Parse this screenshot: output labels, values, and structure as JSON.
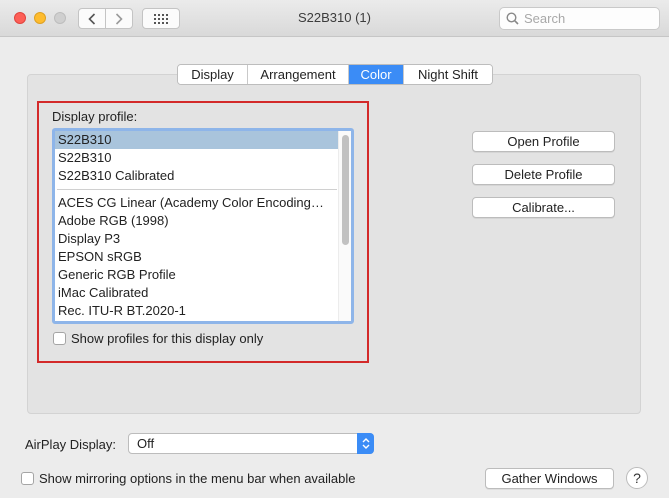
{
  "window": {
    "title": "S22B310 (1)",
    "search_placeholder": "Search"
  },
  "tabs": [
    {
      "label": "Display",
      "active": false
    },
    {
      "label": "Arrangement",
      "active": false
    },
    {
      "label": "Color",
      "active": true
    },
    {
      "label": "Night Shift",
      "active": false
    }
  ],
  "color_pane": {
    "profile_label": "Display profile:",
    "profiles_top": [
      "S22B310",
      "S22B310",
      "S22B310 Calibrated"
    ],
    "profiles_bottom": [
      "ACES CG Linear (Academy Color Encoding…",
      "Adobe RGB (1998)",
      "Display P3",
      "EPSON  sRGB",
      "Generic RGB Profile",
      "iMac Calibrated",
      "Rec. ITU-R BT.2020-1"
    ],
    "selected_profile_index": 0,
    "show_for_display_only_label": "Show profiles for this display only",
    "show_for_display_only_checked": false,
    "open_profile_label": "Open Profile",
    "delete_profile_label": "Delete Profile",
    "calibrate_label": "Calibrate..."
  },
  "footer": {
    "airplay_label": "AirPlay Display:",
    "airplay_value": "Off",
    "mirroring_label": "Show mirroring options in the menu bar when available",
    "mirroring_checked": false,
    "gather_windows_label": "Gather Windows",
    "help_label": "?"
  },
  "colors": {
    "accent": "#3b8cf6",
    "selection": "#a9c4dc",
    "highlight_box": "#d32a2a"
  }
}
